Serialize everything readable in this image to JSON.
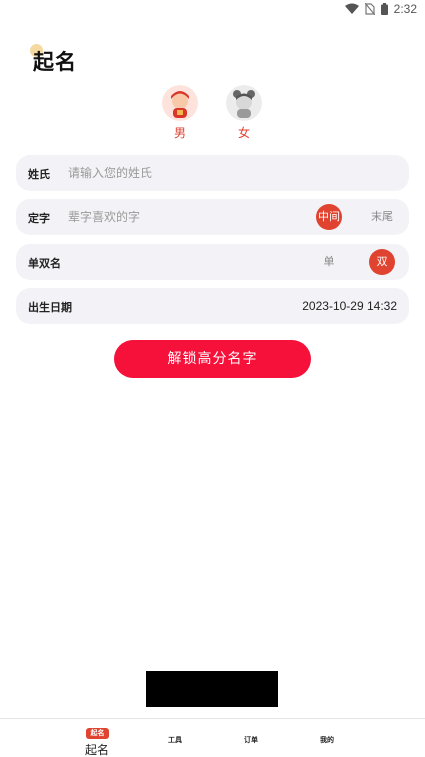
{
  "status_bar": {
    "time": "2:32"
  },
  "header": {
    "title": "起名"
  },
  "gender": [
    {
      "label": "男",
      "icon": "boy-avatar-icon"
    },
    {
      "label": "女",
      "icon": "girl-avatar-icon"
    }
  ],
  "form": {
    "surname": {
      "label": "姓氏",
      "placeholder": "请输入您的姓氏",
      "value": ""
    },
    "fixed_char": {
      "label": "定字",
      "placeholder": "辈字喜欢的字",
      "value": "",
      "options": [
        "中间",
        "末尾"
      ],
      "selected": "中间"
    },
    "single_double": {
      "label": "单双名",
      "options": [
        "单",
        "双"
      ],
      "selected": "双"
    },
    "birth": {
      "label": "出生日期",
      "value": "2023-10-29 14:32"
    }
  },
  "unlock_button": "解锁高分名字",
  "tabbar": {
    "badge": "起名",
    "items": [
      {
        "label": "起名"
      },
      {
        "label": "工具"
      },
      {
        "label": "订单"
      },
      {
        "label": "我的"
      }
    ]
  },
  "colors": {
    "accent": "#e0432f",
    "primary_button": "#f5113a",
    "row_bg": "#f3f3f7"
  }
}
